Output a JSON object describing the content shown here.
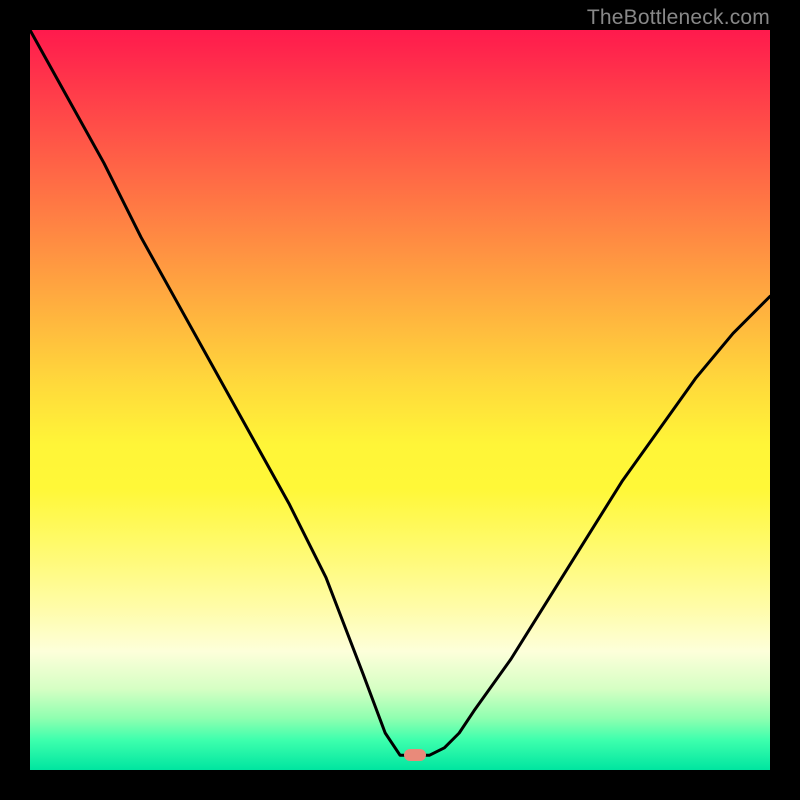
{
  "watermark": "TheBottleneck.com",
  "chart_data": {
    "type": "line",
    "title": "",
    "xlabel": "",
    "ylabel": "",
    "xlim": [
      0,
      100
    ],
    "ylim": [
      0,
      100
    ],
    "grid": false,
    "legend": false,
    "background_gradient_meaning": "bottleneck severity (red=high, green=low)",
    "series": [
      {
        "name": "bottleneck-curve",
        "x": [
          0,
          5,
          10,
          15,
          20,
          25,
          30,
          35,
          40,
          45,
          48,
          50,
          52,
          54,
          56,
          58,
          60,
          65,
          70,
          75,
          80,
          85,
          90,
          95,
          100
        ],
        "y": [
          100,
          91,
          82,
          72,
          63,
          54,
          45,
          36,
          26,
          13,
          5,
          2,
          2,
          2,
          3,
          5,
          8,
          15,
          23,
          31,
          39,
          46,
          53,
          59,
          64
        ]
      }
    ],
    "annotations": [
      {
        "name": "optimal-marker",
        "x": 52,
        "y": 2
      }
    ]
  }
}
